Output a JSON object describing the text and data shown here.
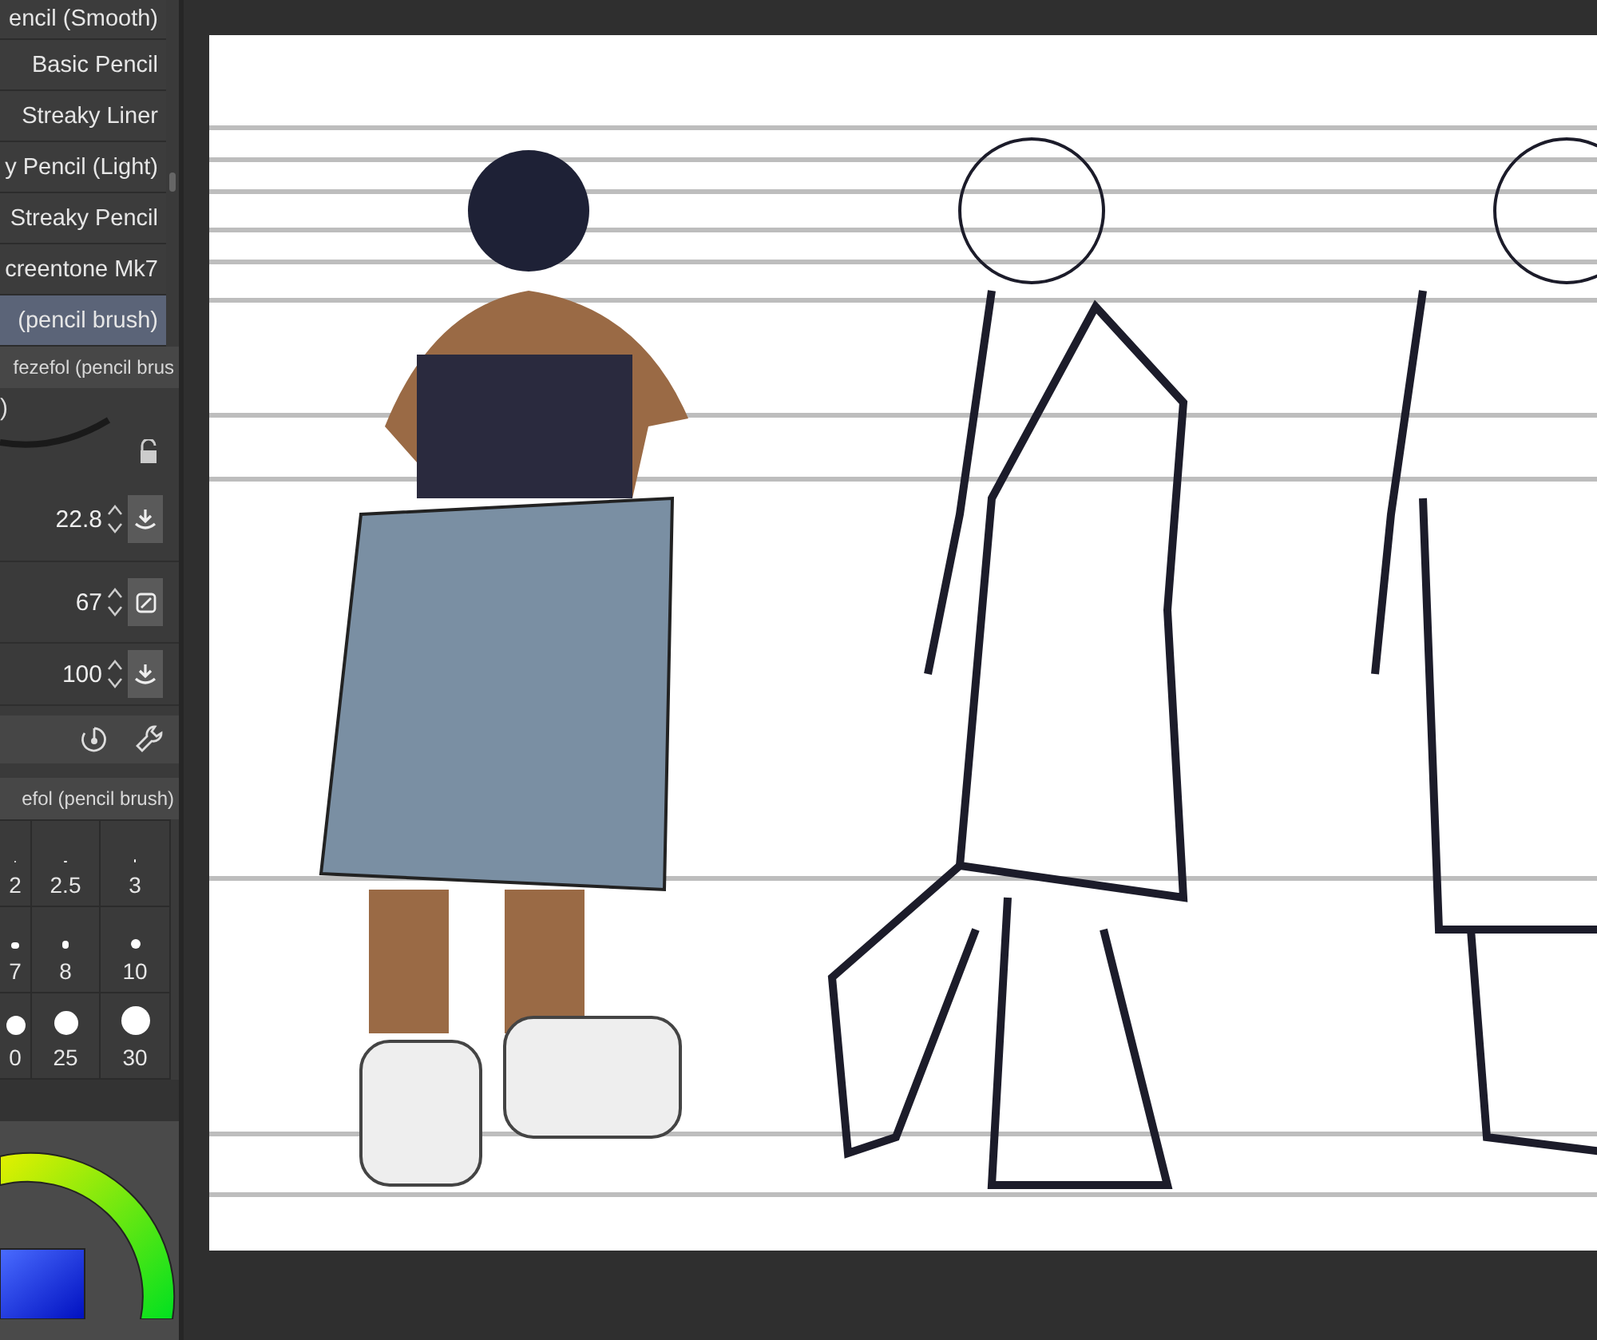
{
  "brush_list": [
    {
      "label": "encil (Smooth)",
      "selected": false
    },
    {
      "label": "Basic Pencil",
      "selected": false
    },
    {
      "label": "Streaky Liner",
      "selected": false
    },
    {
      "label": "y Pencil (Light)",
      "selected": false
    },
    {
      "label": "Streaky Pencil",
      "selected": false
    },
    {
      "label": "creentone Mk7",
      "selected": false
    },
    {
      "label": "(pencil brush)",
      "selected": true
    }
  ],
  "tool_property": {
    "title": "fezefol (pencil brus",
    "preview_label": ")",
    "settings": [
      {
        "value": "22.8",
        "kind": "arrow"
      },
      {
        "value": "67",
        "kind": "slash"
      },
      {
        "value": "100",
        "kind": "arrow"
      }
    ]
  },
  "brush_size": {
    "title": "efol (pencil brush)",
    "sizes": [
      "2",
      "2.5",
      "3",
      "7",
      "8",
      "10",
      "0",
      "25",
      "30"
    ]
  }
}
